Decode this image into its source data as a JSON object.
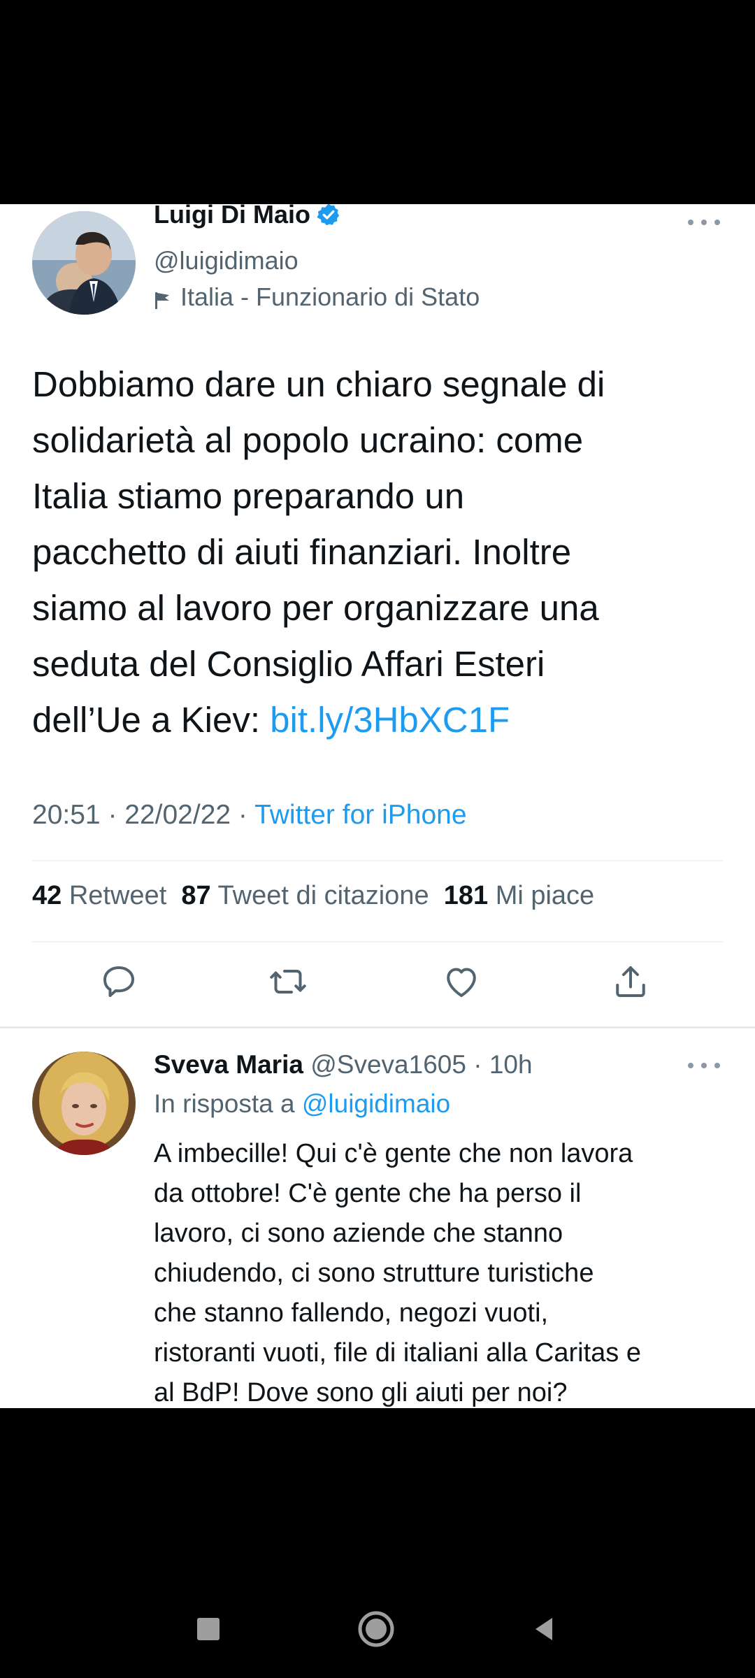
{
  "tweet": {
    "author_name": "Luigi Di Maio",
    "handle": "@luigidimaio",
    "label": "Italia - Funzionario di Stato",
    "text_lines": [
      "Dobbiamo dare un chiaro segnale di",
      "solidarietà al popolo ucraino: come",
      "Italia stiamo preparando un",
      "pacchetto di aiuti finanziari. Inoltre",
      "siamo al lavoro per organizzare una",
      "seduta del Consiglio Affari Esteri"
    ],
    "last_line_text": "dell’Ue a Kiev: ",
    "link": "bit.ly/3HbXC1F",
    "time": "20:51",
    "date": "22/02/22",
    "source": "Twitter for iPhone",
    "separator": " · ",
    "retweets": "42",
    "retweets_label": "Retweet",
    "quotes": "87",
    "quotes_label": "Tweet di citazione",
    "likes": "181",
    "likes_label": "Mi piace"
  },
  "reply": {
    "author_name": "Sveva Maria",
    "handle": "@Sveva1605",
    "age": "10h",
    "replying_to_label": "In risposta a",
    "replying_to": "@luigidimaio",
    "text_lines": [
      "A imbecille! Qui c'è gente che non lavora",
      "da ottobre! C'è gente che ha perso il",
      "lavoro, ci sono aziende che stanno",
      "chiudendo, ci sono strutture turistiche",
      "che stanno fallendo, negozi vuoti,",
      "ristoranti vuoti, file di italiani alla Caritas e",
      "al BdP! Dove sono gli aiuti per noi?"
    ]
  },
  "icons": {
    "verified": "verified-badge-icon",
    "label": "flag-icon",
    "more": "more-options-icon",
    "reply": "reply-icon",
    "retweet": "retweet-icon",
    "like": "heart-icon",
    "share": "share-icon",
    "nav_recents": "recents-square-icon",
    "nav_home": "home-circle-icon",
    "nav_back": "back-triangle-icon"
  },
  "colors": {
    "link": "#1d9bf0",
    "text": "#0f1419",
    "secondary": "#536471",
    "verified": "#1d9bf0",
    "background": "#ffffff",
    "frame": "#000000"
  }
}
